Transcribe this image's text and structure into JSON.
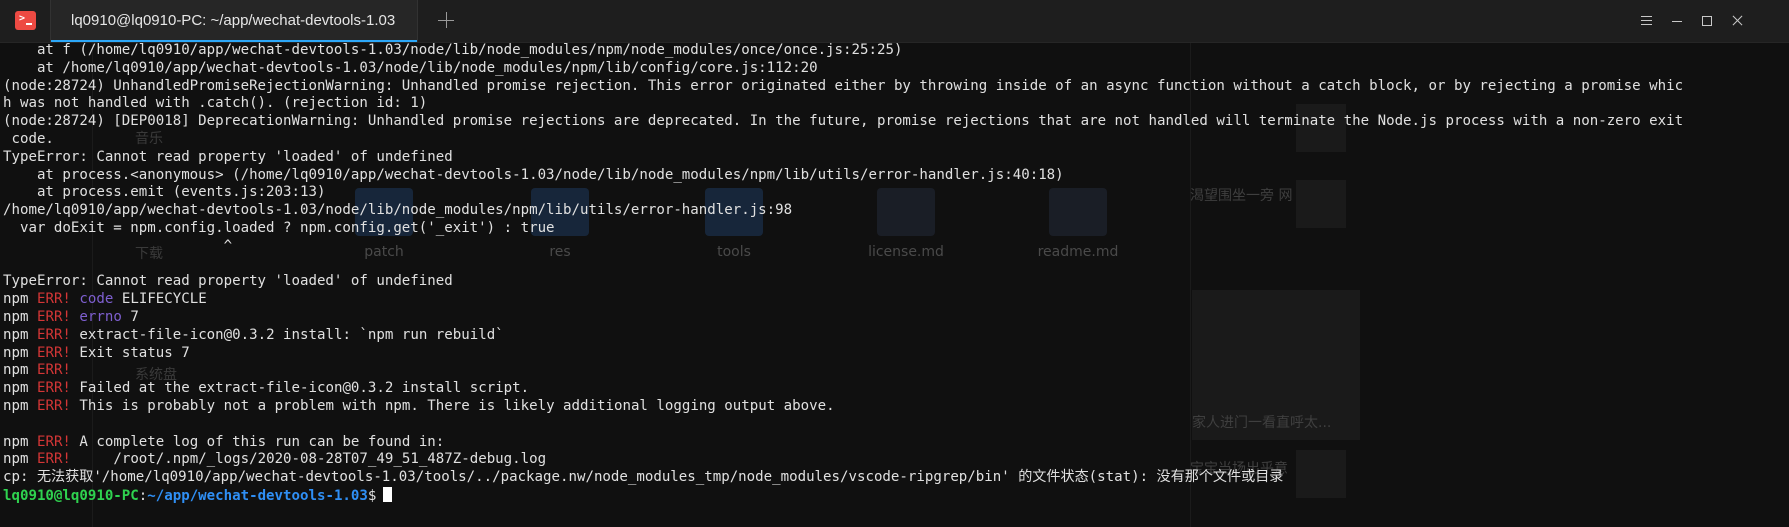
{
  "window": {
    "tab_title": "lq0910@lq0910-PC: ~/app/wechat-devtools-1.03",
    "app_icon": "terminal-icon",
    "controls": [
      "menu-icon",
      "minimize-icon",
      "maximize-icon",
      "close-icon"
    ]
  },
  "terminal": {
    "lines": [
      "    at f (/home/lq0910/app/wechat-devtools-1.03/node/lib/node_modules/npm/node_modules/once/once.js:25:25)",
      "    at /home/lq0910/app/wechat-devtools-1.03/node/lib/node_modules/npm/lib/config/core.js:112:20",
      "(node:28724) UnhandledPromiseRejectionWarning: Unhandled promise rejection. This error originated either by throwing inside of an async function without a catch block, or by rejecting a promise whic",
      "h was not handled with .catch(). (rejection id: 1)",
      "(node:28724) [DEP0018] DeprecationWarning: Unhandled promise rejections are deprecated. In the future, promise rejections that are not handled will terminate the Node.js process with a non-zero exit",
      " code.",
      "TypeError: Cannot read property 'loaded' of undefined",
      "    at process.<anonymous> (/home/lq0910/app/wechat-devtools-1.03/node/lib/node_modules/npm/lib/utils/error-handler.js:40:18)",
      "    at process.emit (events.js:203:13)",
      "/home/lq0910/app/wechat-devtools-1.03/node/lib/node_modules/npm/lib/utils/error-handler.js:98",
      "  var doExit = npm.config.loaded ? npm.config.get('_exit') : true",
      "                          ^",
      "",
      "TypeError: Cannot read property 'loaded' of undefined"
    ],
    "npm_prefix": "npm",
    "err_tag": "ERR!",
    "npm_lines": [
      {
        "keyword": "code",
        "text": " ELIFECYCLE"
      },
      {
        "keyword": "errno",
        "text": " 7"
      },
      {
        "keyword": "",
        "text": " extract-file-icon@0.3.2 install: `npm run rebuild`"
      },
      {
        "keyword": "",
        "text": " Exit status 7"
      },
      {
        "keyword": "",
        "text": ""
      },
      {
        "keyword": "",
        "text": " Failed at the extract-file-icon@0.3.2 install script."
      },
      {
        "keyword": "",
        "text": " This is probably not a problem with npm. There is likely additional logging output above."
      }
    ],
    "npm_lines_2": [
      {
        "keyword": "",
        "text": " A complete log of this run can be found in:"
      },
      {
        "keyword": "",
        "text": "     /root/.npm/_logs/2020-08-28T07_49_51_487Z-debug.log"
      }
    ],
    "cp_error": "cp: 无法获取'/home/lq0910/app/wechat-devtools-1.03/tools/../package.nw/node_modules_tmp/node_modules/vscode-ripgrep/bin' 的文件状态(stat): 没有那个文件或目录",
    "prompt": {
      "user_host": "lq0910@lq0910-PC",
      "separator": ":",
      "path": "~/app/wechat-devtools-1.03",
      "symbol": "$"
    }
  },
  "background": {
    "files": [
      "patch",
      "res",
      "tools",
      "license.md",
      "readme.md"
    ],
    "sidebar_items": [
      "音乐",
      "下载",
      "系统盘"
    ],
    "captions": [
      "渴望围坐一旁 网",
      "家人进门一看直呼太...",
      "宝宝当场出乎意"
    ]
  },
  "colors": {
    "err": "#d33636",
    "keyword": "#7e5fd0",
    "prompt_user": "#2fd24f",
    "prompt_path": "#2f8ff5",
    "tab_accent": "#2ca7f8",
    "app_icon": "#ed4a43"
  }
}
